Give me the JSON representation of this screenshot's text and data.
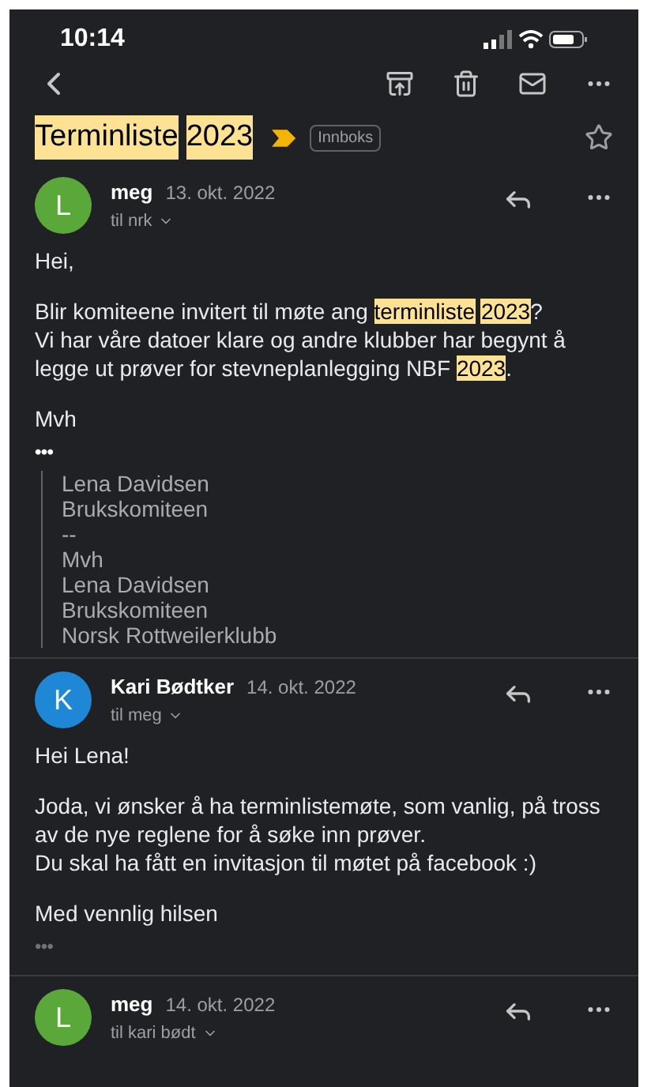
{
  "status_bar": {
    "time": "10:14"
  },
  "subject": {
    "segments": [
      {
        "text": "Terminliste",
        "highlighted": true
      },
      {
        "text": "2023",
        "highlighted": true
      }
    ],
    "important": true,
    "label": "Innboks",
    "starred": false
  },
  "messages": [
    {
      "avatar_letter": "L",
      "color": "#5aa83a",
      "sender": "meg",
      "date": "13. okt. 2022",
      "recipient": "til nrk",
      "paragraphs": [
        [
          [
            {
              "text": "Hei,",
              "highlighted": false
            }
          ]
        ],
        [
          [
            {
              "text": "Blir komiteene invitert til møte ang",
              "highlighted": false
            },
            {
              "text": "terminliste",
              "highlighted": true,
              "space_before": true
            },
            {
              "text": "2023",
              "highlighted": true,
              "space_before": true
            },
            {
              "text": "?",
              "highlighted": false
            }
          ],
          [
            {
              "text": "Vi har våre datoer klare og andre klubber har begynt å legge ut prøver for stevneplanlegging NBF",
              "highlighted": false
            },
            {
              "text": "2023",
              "highlighted": true,
              "space_before": true
            },
            {
              "text": ".",
              "highlighted": false
            }
          ]
        ],
        [
          [
            {
              "text": "Mvh",
              "highlighted": false
            }
          ]
        ]
      ],
      "ellipsis": "•••",
      "quote": [
        "Lena Davidsen",
        "Brukskomiteen",
        "--",
        "Mvh",
        "Lena Davidsen",
        "Brukskomiteen",
        "Norsk Rottweilerklubb"
      ]
    },
    {
      "avatar_letter": "K",
      "color": "#1e88d6",
      "sender": "Kari Bødtker",
      "date": "14. okt. 2022",
      "recipient": "til meg",
      "paragraphs": [
        [
          [
            {
              "text": "Hei Lena!",
              "highlighted": false
            }
          ]
        ],
        [
          [
            {
              "text": "Joda, vi ønsker å ha terminlistemøte, som vanlig, på tross av de nye reglene for å søke inn prøver.",
              "highlighted": false
            }
          ],
          [
            {
              "text": "Du skal ha fått en invitasjon til møtet på facebook :)",
              "highlighted": false
            }
          ]
        ],
        [
          [
            {
              "text": "Med vennlig hilsen",
              "highlighted": false
            }
          ]
        ]
      ],
      "ellipsis": "•••"
    },
    {
      "avatar_letter": "L",
      "color": "#5aa83a",
      "sender": "meg",
      "date": "14. okt. 2022",
      "recipient": "til kari bødt"
    }
  ]
}
